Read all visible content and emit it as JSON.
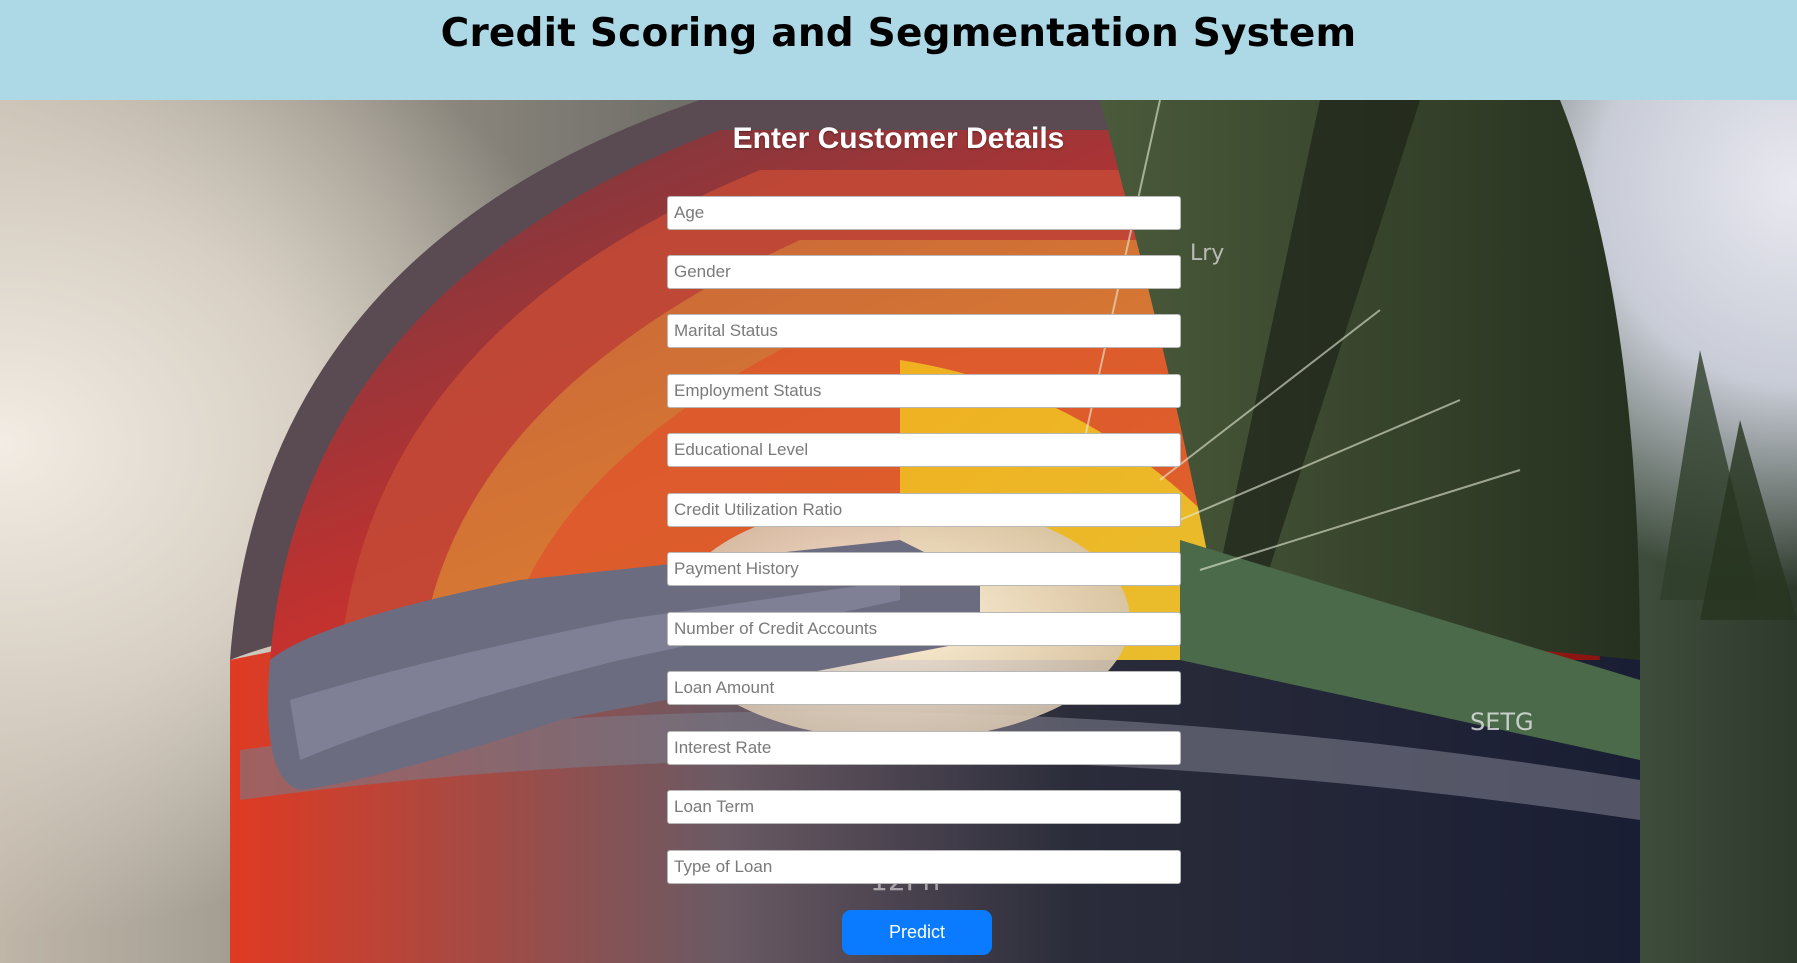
{
  "header": {
    "title": "Credit Scoring and Segmentation System"
  },
  "form": {
    "title": "Enter Customer Details",
    "fields": [
      {
        "placeholder": "Age",
        "value": ""
      },
      {
        "placeholder": "Gender",
        "value": ""
      },
      {
        "placeholder": "Marital Status",
        "value": ""
      },
      {
        "placeholder": "Employment Status",
        "value": ""
      },
      {
        "placeholder": "Educational Level",
        "value": ""
      },
      {
        "placeholder": "Credit Utilization Ratio",
        "value": ""
      },
      {
        "placeholder": "Payment History",
        "value": ""
      },
      {
        "placeholder": "Number of Credit Accounts",
        "value": ""
      },
      {
        "placeholder": "Loan Amount",
        "value": ""
      },
      {
        "placeholder": "Interest Rate",
        "value": ""
      },
      {
        "placeholder": "Loan Term",
        "value": ""
      },
      {
        "placeholder": "Type of Loan",
        "value": ""
      }
    ],
    "submit_label": "Predict"
  },
  "colors": {
    "header_bg": "#add8e6",
    "button_bg": "#0a7bff",
    "form_title": "#ffffff"
  }
}
